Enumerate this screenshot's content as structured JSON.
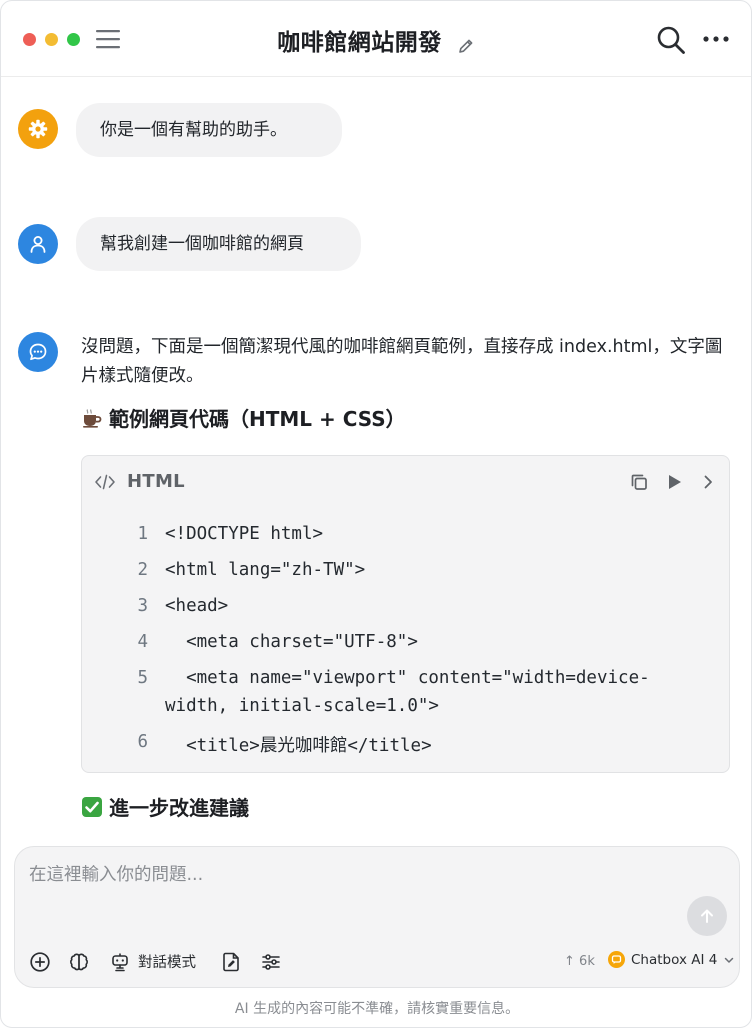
{
  "header": {
    "title": "咖啡館網站開發"
  },
  "messages": {
    "system": {
      "text": "你是一個有幫助的助手。",
      "avatar_icon": "gear-icon"
    },
    "user": {
      "text": "幫我創建一個咖啡館的網頁",
      "avatar_icon": "user-icon"
    },
    "assistant": {
      "avatar_icon": "chat-bubble-icon",
      "intro": "沒問題，下面是一個簡潔現代風的咖啡館網頁範例，直接存成 index.html，文字圖片樣式隨便改。",
      "heading_example": "範例網頁代碼（HTML + CSS）",
      "heading_improve": "進一步改進建議"
    }
  },
  "code_block": {
    "language": "HTML",
    "lines": [
      {
        "n": "1",
        "text": "<!DOCTYPE html>"
      },
      {
        "n": "2",
        "text": "<html lang=\"zh-TW\">"
      },
      {
        "n": "3",
        "text": "<head>"
      },
      {
        "n": "4",
        "text": "  <meta charset=\"UTF-8\">"
      },
      {
        "n": "5",
        "text": "  <meta name=\"viewport\" content=\"width=device-",
        "cont": "width, initial-scale=1.0\">"
      },
      {
        "n": "6",
        "text": "  <title>晨光咖啡館</title>"
      }
    ]
  },
  "composer": {
    "placeholder": "在這裡輸入你的問題...",
    "mode_label": "對話模式",
    "tokens": "6k",
    "model": "Chatbox AI 4"
  },
  "disclaimer": "AI 生成的內容可能不準確，請核實重要信息。",
  "colors": {
    "system_avatar": "#f3a10e",
    "user_avatar": "#2d86e0",
    "bubble_bg": "#f2f2f3",
    "code_bg": "#f4f4f5"
  }
}
